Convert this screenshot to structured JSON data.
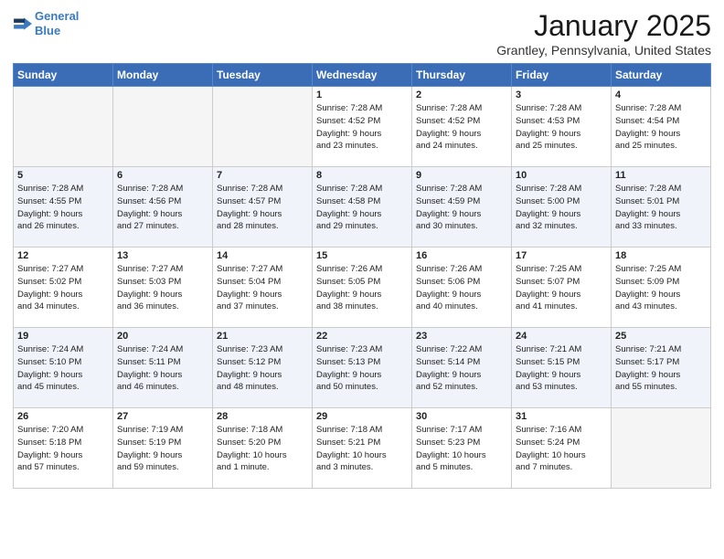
{
  "header": {
    "logo_line1": "General",
    "logo_line2": "Blue",
    "month": "January 2025",
    "location": "Grantley, Pennsylvania, United States"
  },
  "days_of_week": [
    "Sunday",
    "Monday",
    "Tuesday",
    "Wednesday",
    "Thursday",
    "Friday",
    "Saturday"
  ],
  "weeks": [
    [
      {
        "day": "",
        "info": ""
      },
      {
        "day": "",
        "info": ""
      },
      {
        "day": "",
        "info": ""
      },
      {
        "day": "1",
        "info": "Sunrise: 7:28 AM\nSunset: 4:52 PM\nDaylight: 9 hours\nand 23 minutes."
      },
      {
        "day": "2",
        "info": "Sunrise: 7:28 AM\nSunset: 4:52 PM\nDaylight: 9 hours\nand 24 minutes."
      },
      {
        "day": "3",
        "info": "Sunrise: 7:28 AM\nSunset: 4:53 PM\nDaylight: 9 hours\nand 25 minutes."
      },
      {
        "day": "4",
        "info": "Sunrise: 7:28 AM\nSunset: 4:54 PM\nDaylight: 9 hours\nand 25 minutes."
      }
    ],
    [
      {
        "day": "5",
        "info": "Sunrise: 7:28 AM\nSunset: 4:55 PM\nDaylight: 9 hours\nand 26 minutes."
      },
      {
        "day": "6",
        "info": "Sunrise: 7:28 AM\nSunset: 4:56 PM\nDaylight: 9 hours\nand 27 minutes."
      },
      {
        "day": "7",
        "info": "Sunrise: 7:28 AM\nSunset: 4:57 PM\nDaylight: 9 hours\nand 28 minutes."
      },
      {
        "day": "8",
        "info": "Sunrise: 7:28 AM\nSunset: 4:58 PM\nDaylight: 9 hours\nand 29 minutes."
      },
      {
        "day": "9",
        "info": "Sunrise: 7:28 AM\nSunset: 4:59 PM\nDaylight: 9 hours\nand 30 minutes."
      },
      {
        "day": "10",
        "info": "Sunrise: 7:28 AM\nSunset: 5:00 PM\nDaylight: 9 hours\nand 32 minutes."
      },
      {
        "day": "11",
        "info": "Sunrise: 7:28 AM\nSunset: 5:01 PM\nDaylight: 9 hours\nand 33 minutes."
      }
    ],
    [
      {
        "day": "12",
        "info": "Sunrise: 7:27 AM\nSunset: 5:02 PM\nDaylight: 9 hours\nand 34 minutes."
      },
      {
        "day": "13",
        "info": "Sunrise: 7:27 AM\nSunset: 5:03 PM\nDaylight: 9 hours\nand 36 minutes."
      },
      {
        "day": "14",
        "info": "Sunrise: 7:27 AM\nSunset: 5:04 PM\nDaylight: 9 hours\nand 37 minutes."
      },
      {
        "day": "15",
        "info": "Sunrise: 7:26 AM\nSunset: 5:05 PM\nDaylight: 9 hours\nand 38 minutes."
      },
      {
        "day": "16",
        "info": "Sunrise: 7:26 AM\nSunset: 5:06 PM\nDaylight: 9 hours\nand 40 minutes."
      },
      {
        "day": "17",
        "info": "Sunrise: 7:25 AM\nSunset: 5:07 PM\nDaylight: 9 hours\nand 41 minutes."
      },
      {
        "day": "18",
        "info": "Sunrise: 7:25 AM\nSunset: 5:09 PM\nDaylight: 9 hours\nand 43 minutes."
      }
    ],
    [
      {
        "day": "19",
        "info": "Sunrise: 7:24 AM\nSunset: 5:10 PM\nDaylight: 9 hours\nand 45 minutes."
      },
      {
        "day": "20",
        "info": "Sunrise: 7:24 AM\nSunset: 5:11 PM\nDaylight: 9 hours\nand 46 minutes."
      },
      {
        "day": "21",
        "info": "Sunrise: 7:23 AM\nSunset: 5:12 PM\nDaylight: 9 hours\nand 48 minutes."
      },
      {
        "day": "22",
        "info": "Sunrise: 7:23 AM\nSunset: 5:13 PM\nDaylight: 9 hours\nand 50 minutes."
      },
      {
        "day": "23",
        "info": "Sunrise: 7:22 AM\nSunset: 5:14 PM\nDaylight: 9 hours\nand 52 minutes."
      },
      {
        "day": "24",
        "info": "Sunrise: 7:21 AM\nSunset: 5:15 PM\nDaylight: 9 hours\nand 53 minutes."
      },
      {
        "day": "25",
        "info": "Sunrise: 7:21 AM\nSunset: 5:17 PM\nDaylight: 9 hours\nand 55 minutes."
      }
    ],
    [
      {
        "day": "26",
        "info": "Sunrise: 7:20 AM\nSunset: 5:18 PM\nDaylight: 9 hours\nand 57 minutes."
      },
      {
        "day": "27",
        "info": "Sunrise: 7:19 AM\nSunset: 5:19 PM\nDaylight: 9 hours\nand 59 minutes."
      },
      {
        "day": "28",
        "info": "Sunrise: 7:18 AM\nSunset: 5:20 PM\nDaylight: 10 hours\nand 1 minute."
      },
      {
        "day": "29",
        "info": "Sunrise: 7:18 AM\nSunset: 5:21 PM\nDaylight: 10 hours\nand 3 minutes."
      },
      {
        "day": "30",
        "info": "Sunrise: 7:17 AM\nSunset: 5:23 PM\nDaylight: 10 hours\nand 5 minutes."
      },
      {
        "day": "31",
        "info": "Sunrise: 7:16 AM\nSunset: 5:24 PM\nDaylight: 10 hours\nand 7 minutes."
      },
      {
        "day": "",
        "info": ""
      }
    ]
  ]
}
